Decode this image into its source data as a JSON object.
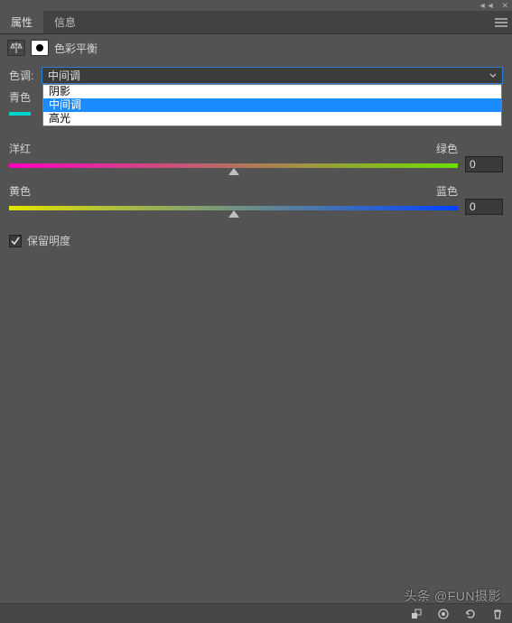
{
  "window": {
    "collapse_icon": "chevrons-left",
    "close_icon": "close"
  },
  "tabs": {
    "active": "属性",
    "inactive": "信息"
  },
  "header": {
    "title": "色彩平衡"
  },
  "tone": {
    "label": "色调:",
    "value": "中间调",
    "options": [
      "阴影",
      "中间调",
      "高光"
    ],
    "selected_index": 1
  },
  "cyan_label": "青色",
  "sliders": [
    {
      "left": "洋红",
      "right": "绿色",
      "value": "0"
    },
    {
      "left": "黄色",
      "right": "蓝色",
      "value": "0"
    }
  ],
  "preserve": {
    "label": "保留明度",
    "checked": true
  },
  "watermark": "头条 @FUN摄影"
}
